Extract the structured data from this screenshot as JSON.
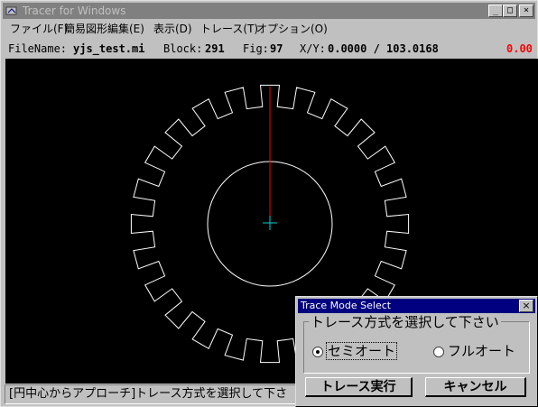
{
  "window": {
    "title": "Tracer for Windows",
    "controls": {
      "minimize": "_",
      "maximize": "□",
      "close": "×"
    }
  },
  "menu": [
    {
      "label": "ファイル(F)"
    },
    {
      "label": "簡易図形編集(E)"
    },
    {
      "label": "表示(D)"
    },
    {
      "label": "トレース(T)"
    },
    {
      "label": "オプション(O)"
    }
  ],
  "info": {
    "filename_label": "FileName:",
    "filename": "yjs_test.mi",
    "block_label": "Block:",
    "block": "291",
    "fig_label": "Fig:",
    "fig": "97",
    "xy_label": "X/Y:",
    "xy": "0.0000 / 103.0168",
    "red_value": "0.00"
  },
  "status": {
    "text": "[円中心からアプローチ]トレース方式を選択して下さ"
  },
  "dialog": {
    "title": "Trace Mode Select",
    "close": "×",
    "prompt": "トレース方式を選択して下さい",
    "options": [
      {
        "label": "セミオート",
        "selected": true
      },
      {
        "label": "フルオート",
        "selected": false
      }
    ],
    "ok_label": "トレース実行",
    "cancel_label": "キャンセル"
  },
  "colors": {
    "canvas_bg": "#000000",
    "gear_stroke": "#ffffff",
    "approach_line": "#ff0000",
    "center_mark": "#00cccc",
    "dialog_title_bg": "#000080",
    "title_inactive_bg": "#808080"
  }
}
